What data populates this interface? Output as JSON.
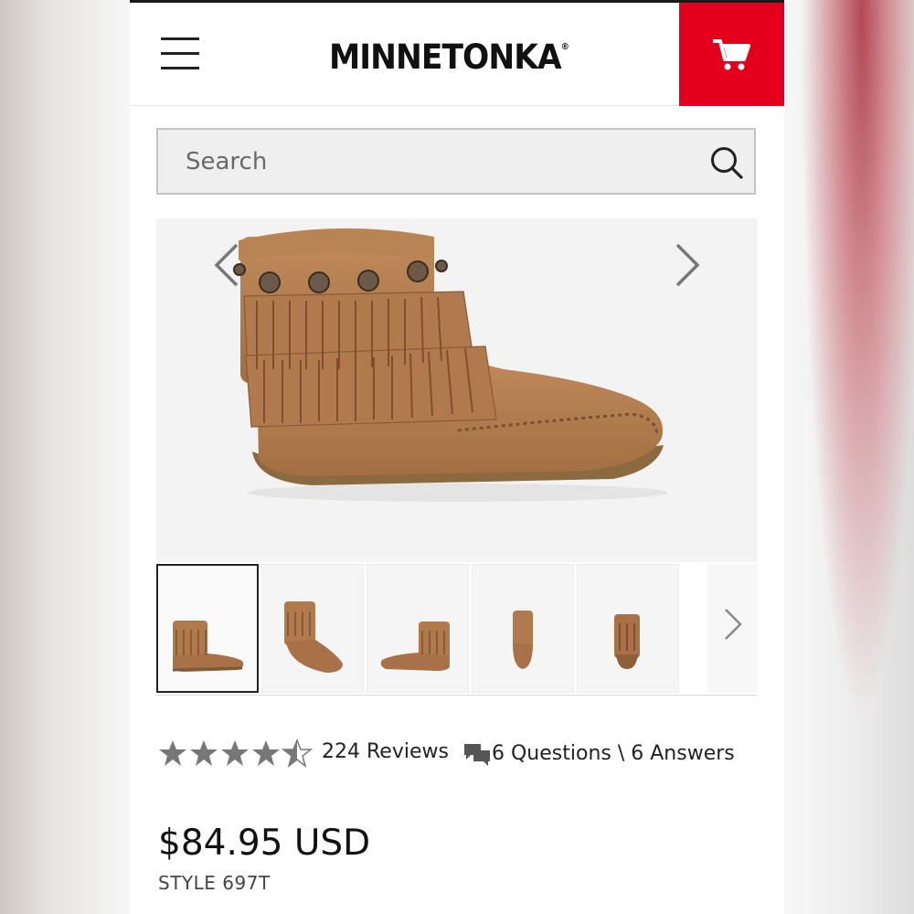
{
  "header": {
    "menu_icon": "hamburger-menu-icon",
    "brand": "MINNETONKA",
    "brand_mark": "®",
    "cart_icon": "shopping-cart-icon",
    "cart_bg": "#e4001c"
  },
  "search": {
    "placeholder": "Search",
    "icon": "search-icon"
  },
  "gallery": {
    "prev_icon": "chevron-left-icon",
    "next_icon": "chevron-right-icon",
    "thumb_count": 6,
    "active_thumb": 1
  },
  "rating": {
    "value": 4.5,
    "max": 5,
    "reviews_label": "224 Reviews",
    "qa_icon": "chat-bubbles-icon",
    "qa_label": "6 Questions \\ 6 Answers"
  },
  "product": {
    "price": "$84.95 USD",
    "style": "STYLE 697T"
  },
  "colors": {
    "accent": "#e4001c",
    "suede": "#b07a4c"
  }
}
